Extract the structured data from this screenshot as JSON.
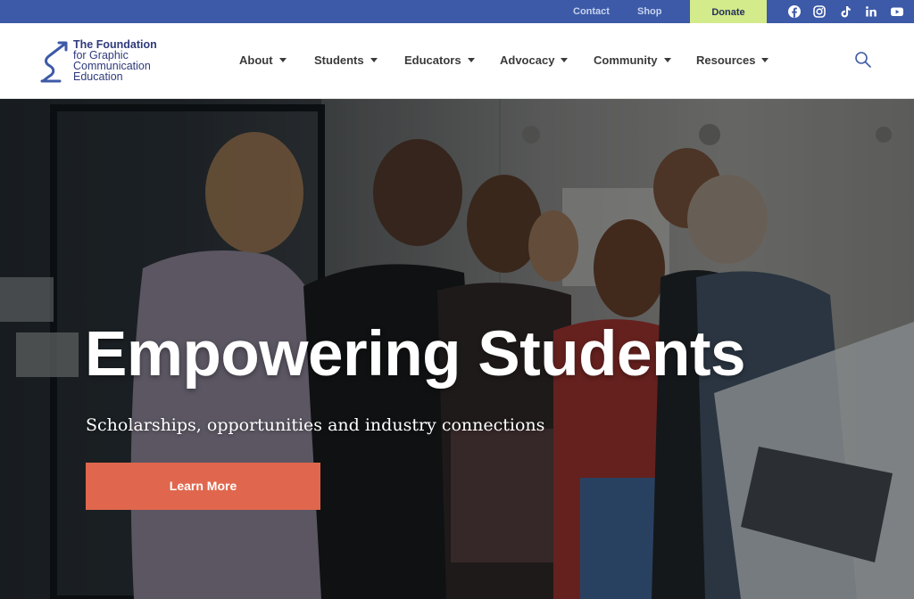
{
  "topbar": {
    "contact": "Contact",
    "shop": "Shop",
    "donate": "Donate",
    "social": [
      "facebook-icon",
      "instagram-icon",
      "tiktok-icon",
      "linkedin-icon",
      "youtube-icon"
    ]
  },
  "logo": {
    "line1": "The Foundation",
    "line2": "for Graphic",
    "line3": "Communication",
    "line4": "Education"
  },
  "nav": {
    "items": [
      {
        "label": "About"
      },
      {
        "label": "Students"
      },
      {
        "label": "Educators"
      },
      {
        "label": "Advocacy"
      },
      {
        "label": "Community"
      },
      {
        "label": "Resources"
      }
    ]
  },
  "hero": {
    "title": "Empowering Students",
    "subtitle": "Scholarships, opportunities and industry connections",
    "cta": "Learn More"
  },
  "colors": {
    "topbar": "#3d5aa8",
    "donate": "#d3eb8a",
    "brand": "#2f3a7d",
    "cta": "#e0674d"
  }
}
